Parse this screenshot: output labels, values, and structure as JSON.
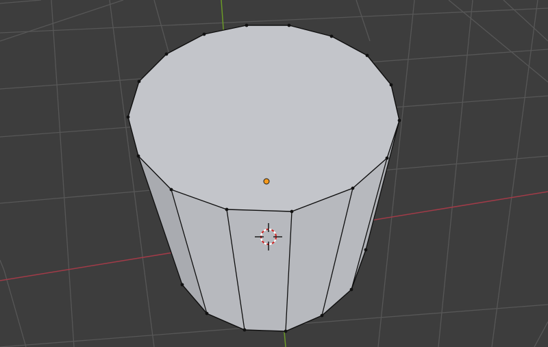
{
  "viewport": {
    "background_color": "#3d3d3d",
    "grid_color": "#575757",
    "x_axis_color": "#a23b48",
    "y_axis_color": "#6b9a27",
    "mesh": {
      "object": "cylinder",
      "mode": "edit",
      "vertex_count": 32,
      "face_color": "#c3c5ca",
      "side_face_color": "#b7b9be",
      "edge_color": "#0e0e0e",
      "vertex_color": "#111111"
    },
    "origin": {
      "icon": "object-origin-dot",
      "color": "#f59a1c"
    },
    "cursor": {
      "icon": "3d-cursor-icon",
      "ring_colors": [
        "#c92a2a",
        "#ffffff"
      ]
    }
  }
}
